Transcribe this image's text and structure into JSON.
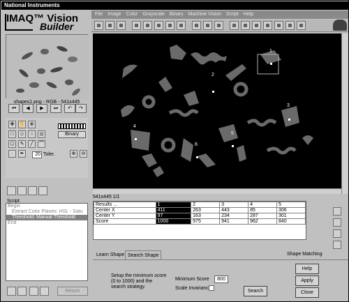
{
  "window": {
    "title": "National Instruments"
  },
  "logo": {
    "line1": "IMAQ™ Vision",
    "line2": "Builder"
  },
  "menu": [
    "File",
    "Image",
    "Color",
    "Grayscale",
    "Binary",
    "Machine Vision",
    "Script",
    "Help"
  ],
  "thumbnail": {
    "label": "shapes1.png - RGB - 541x445"
  },
  "tools": {
    "binary_label": "Binary",
    "tolerance_value": "20",
    "tolerance_label": "Toler."
  },
  "script": {
    "label": "Script",
    "items": [
      {
        "text": "Begin",
        "indent": false,
        "selected": false
      },
      {
        "text": "Extract Color Planes: HSL - Satu",
        "indent": true,
        "selected": false
      },
      {
        "text": "Threshold: Manual Threshold",
        "indent": true,
        "selected": true
      },
      {
        "text": "End",
        "indent": false,
        "selected": false
      }
    ],
    "return_label": "Return"
  },
  "image": {
    "info": "541x445 1/1",
    "markers": [
      "1",
      "2",
      "3",
      "4",
      "5",
      "6"
    ]
  },
  "results": {
    "header": [
      "Results ...",
      "1",
      "2",
      "3",
      "4",
      "5"
    ],
    "rows": [
      [
        "Center X",
        "411",
        "263",
        "443",
        "85",
        "306"
      ],
      [
        "Center Y",
        "97",
        "163",
        "234",
        "287",
        "301"
      ],
      [
        "Score",
        "1000",
        "975",
        "941",
        "962",
        "840"
      ]
    ]
  },
  "tabs": [
    "Learn Shape",
    "Search Shape"
  ],
  "panel": {
    "title": "Shape Matching",
    "help_text": "Setup the minimum score (0 to 1000) and the search strategy.",
    "min_score_label": "Minimum Score",
    "min_score_value": "800",
    "scale_invariance_label": "Scale Invariance",
    "search_label": "Search",
    "help_label": "Help",
    "apply_label": "Apply",
    "close_label": "Close"
  }
}
